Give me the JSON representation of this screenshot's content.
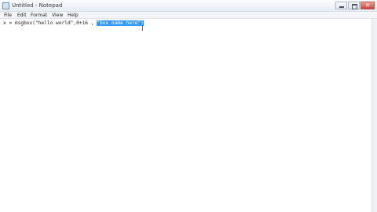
{
  "window": {
    "title": "Untitled - Notepad",
    "icon": "notepad-icon",
    "controls": {
      "minimize": "minimize-icon",
      "maximize": "maximize-icon",
      "close": "✕"
    }
  },
  "menu": {
    "items": [
      "File",
      "Edit",
      "Format",
      "View",
      "Help"
    ]
  },
  "editor": {
    "text_before": "x = msgbox(\"hello world\",0+16 , ",
    "selected_text": "\"box name here\")"
  },
  "colors": {
    "selection": "#3399ff",
    "close_button": "#c7473b"
  }
}
